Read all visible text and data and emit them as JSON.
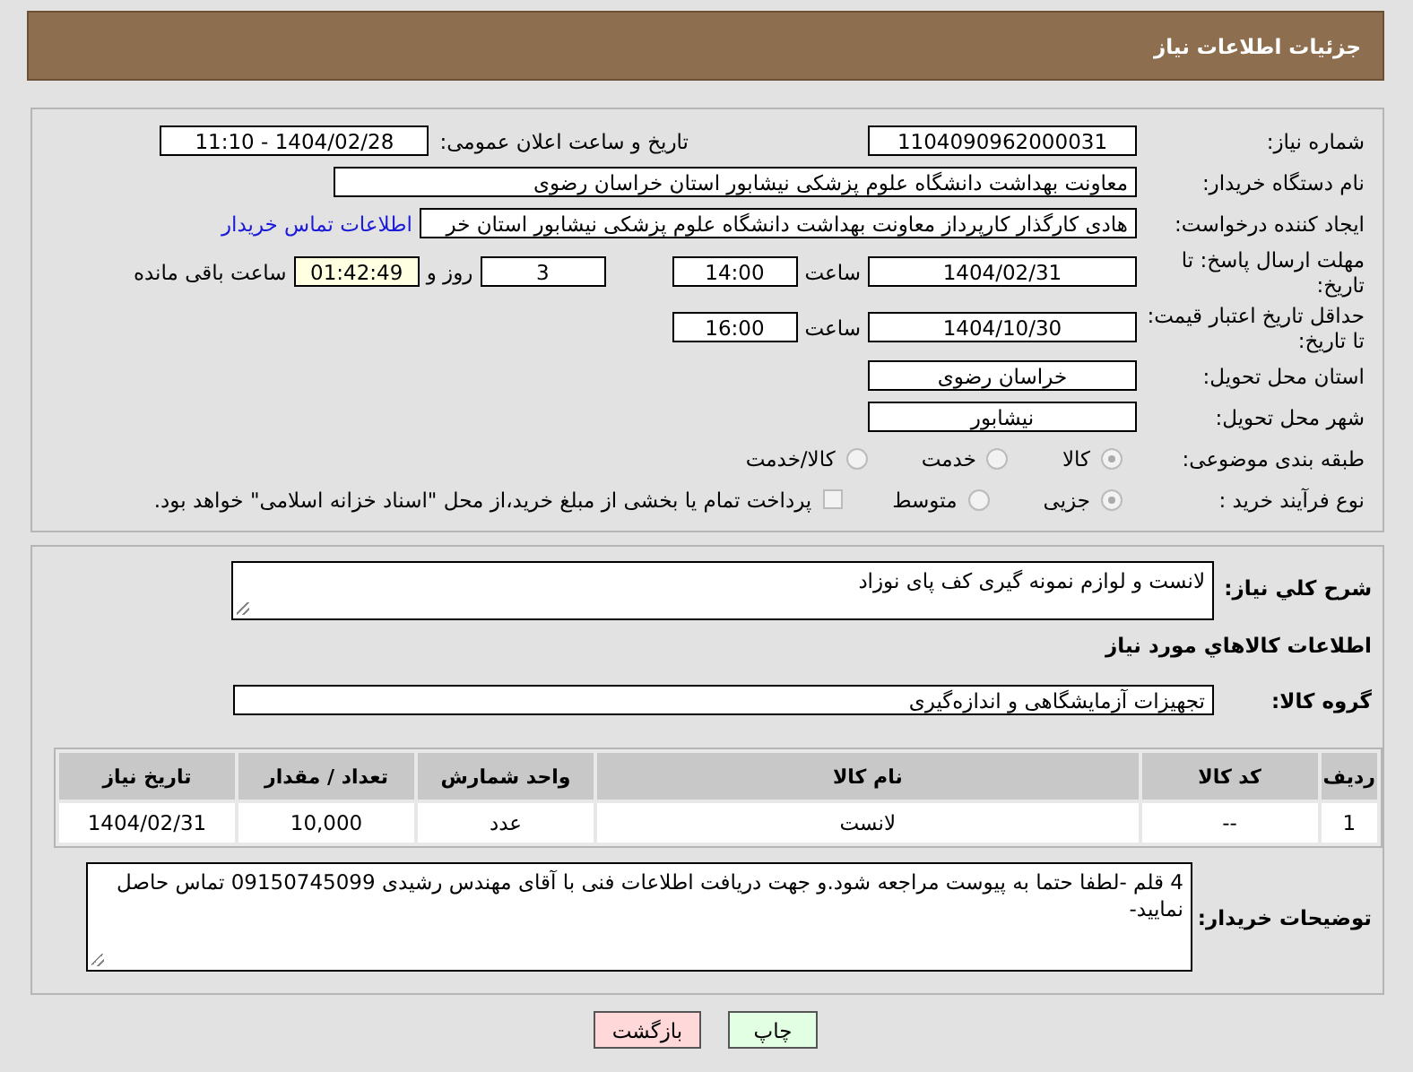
{
  "header": {
    "title": "جزئیات اطلاعات نیاز"
  },
  "details": {
    "need_number": {
      "label": "شماره نیاز:",
      "value": "1104090962000031"
    },
    "announce": {
      "label": "تاریخ و ساعت اعلان عمومی:",
      "value": "1404/02/28 - 11:10"
    },
    "buyer_org": {
      "label": "نام دستگاه خریدار:",
      "value": "معاونت بهداشت دانشگاه علوم پزشکی نیشابور استان خراسان رضوی"
    },
    "creator": {
      "label": "ایجاد کننده درخواست:",
      "value": "هادی کارگذار کارپرداز معاونت بهداشت دانشگاه علوم پزشکی نیشابور استان خر",
      "link": "اطلاعات تماس خریدار"
    },
    "deadline": {
      "label": "مهلت ارسال پاسخ: تا تاریخ:",
      "date": "1404/02/31",
      "time_label": "ساعت",
      "time": "14:00",
      "days": "3",
      "days_label": "روز و",
      "remaining": "01:42:49",
      "remaining_label": "ساعت باقی مانده"
    },
    "validity": {
      "label": "حداقل تاریخ اعتبار قیمت: تا تاریخ:",
      "date": "1404/10/30",
      "time_label": "ساعت",
      "time": "16:00"
    },
    "province": {
      "label": "استان محل تحویل:",
      "value": "خراسان رضوی"
    },
    "city": {
      "label": "شهر محل تحویل:",
      "value": "نیشابور"
    },
    "category": {
      "label": "طبقه بندی موضوعی:",
      "options": [
        {
          "label": "کالا",
          "selected": true
        },
        {
          "label": "خدمت",
          "selected": false
        },
        {
          "label": "کالا/خدمت",
          "selected": false
        }
      ]
    },
    "process": {
      "label": "نوع فرآیند خرید :",
      "options": [
        {
          "label": "جزیی",
          "selected": true
        },
        {
          "label": "متوسط",
          "selected": false
        }
      ],
      "payment": {
        "label": "پرداخت تمام یا بخشی از مبلغ خرید،از محل \"اسناد خزانه اسلامی\" خواهد بود.",
        "checked": false
      }
    }
  },
  "items": {
    "summary": {
      "label": "شرح کلي نياز:",
      "value": "لانست و لوازم نمونه گیری کف پای نوزاد"
    },
    "heading": "اطلاعات کالاهاي مورد نياز",
    "group": {
      "label": "گروه کالا:",
      "value": "تجهیزات آزمایشگاهی و اندازه‌گیری"
    },
    "table": {
      "columns": [
        "ردیف",
        "کد کالا",
        "نام کالا",
        "واحد شمارش",
        "تعداد / مقدار",
        "تاریخ نیاز"
      ],
      "rows": [
        [
          "1",
          "--",
          "لانست",
          "عدد",
          "10,000",
          "1404/02/31"
        ]
      ]
    },
    "notes": {
      "label": "توضیحات خریدار:",
      "value": "4 قلم -لطفا حتما به پیوست مراجعه شود.و جهت دریافت اطلاعات فنی با آقای مهندس رشیدی 09150745099 تماس حاصل نمایید-"
    }
  },
  "buttons": [
    {
      "label": "چاپ",
      "kind": "print"
    },
    {
      "label": "بازگشت",
      "kind": "back"
    }
  ]
}
